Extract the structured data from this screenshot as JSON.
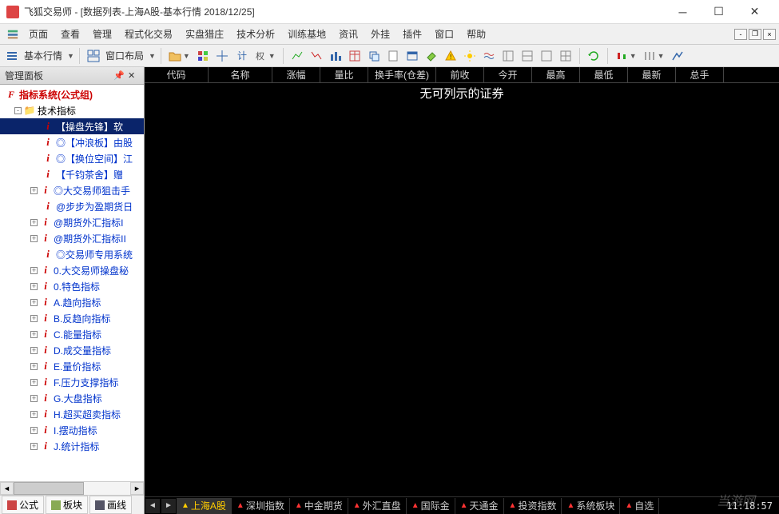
{
  "titlebar": {
    "title": "飞狐交易师 - [数据列表-上海A股-基本行情 2018/12/25]"
  },
  "menu": {
    "items": [
      "页面",
      "查看",
      "管理",
      "程式化交易",
      "实盘猎庄",
      "技术分析",
      "训练基地",
      "资讯",
      "外挂",
      "插件",
      "窗口",
      "帮助"
    ]
  },
  "toolbar": {
    "label1": "基本行情",
    "label2": "窗口布局"
  },
  "panel": {
    "title": "管理面板",
    "root_label": "指标系统(公式组)",
    "tech_label": "技术指标",
    "tabs": [
      "公式",
      "板块",
      "画线"
    ],
    "items": [
      {
        "label": "【操盘先锋】软",
        "selected": true,
        "expandable": false
      },
      {
        "label": "◎【冲浪板】由股",
        "expandable": false
      },
      {
        "label": "◎【换位空间】江",
        "expandable": false
      },
      {
        "label": "【千钧茶舍】赠",
        "expandable": false
      },
      {
        "label": "◎大交易师狙击手",
        "expandable": true
      },
      {
        "label": "@步步为盈期货日",
        "expandable": false
      },
      {
        "label": "@期货外汇指标I",
        "expandable": true
      },
      {
        "label": "@期货外汇指标II",
        "expandable": true
      },
      {
        "label": "◎交易师专用系统",
        "expandable": false
      },
      {
        "label": "0.大交易师操盘秘",
        "expandable": true
      },
      {
        "label": "0.特色指标",
        "expandable": true
      },
      {
        "label": "A.趋向指标",
        "expandable": true
      },
      {
        "label": "B.反趋向指标",
        "expandable": true
      },
      {
        "label": "C.能量指标",
        "expandable": true
      },
      {
        "label": "D.成交量指标",
        "expandable": true
      },
      {
        "label": "E.量价指标",
        "expandable": true
      },
      {
        "label": "F.压力支撑指标",
        "expandable": true
      },
      {
        "label": "G.大盘指标",
        "expandable": true
      },
      {
        "label": "H.超买超卖指标",
        "expandable": true
      },
      {
        "label": "I.摆动指标",
        "expandable": true
      },
      {
        "label": "J.统计指标",
        "expandable": true
      }
    ]
  },
  "columns": [
    "代码",
    "名称",
    "涨幅",
    "量比",
    "换手率(仓差)",
    "前收",
    "今开",
    "最高",
    "最低",
    "最新",
    "总手"
  ],
  "empty_message": "无可列示的证券",
  "market_tabs": [
    "上海A股",
    "深圳指数",
    "中金期货",
    "外汇直盘",
    "国际金",
    "天通金",
    "投资指数",
    "系统板块",
    "自选"
  ],
  "clock": "11:18:57",
  "watermark": "当游网"
}
